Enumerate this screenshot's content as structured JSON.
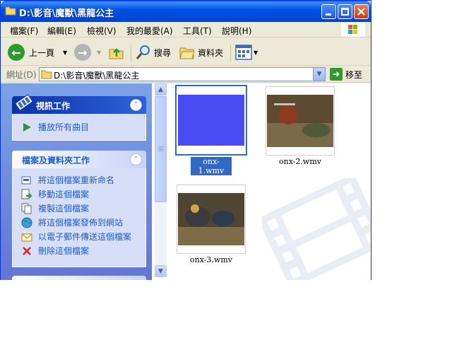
{
  "window": {
    "title": "D:\\影音\\魔獸\\黑龍公主"
  },
  "menubar": {
    "items": [
      "檔案(F)",
      "編輯(E)",
      "檢視(V)",
      "我的最愛(A)",
      "工具(T)",
      "說明(H)"
    ]
  },
  "toolbar": {
    "back_label": "上一頁",
    "search_label": "搜尋",
    "folders_label": "資料夾"
  },
  "address": {
    "label": "網址(D)",
    "value": "D:\\影音\\魔獸\\黑龍公主",
    "go_label": "移至"
  },
  "taskpane": {
    "video_tasks": {
      "title": "視訊工作",
      "items": [
        "播放所有曲目"
      ]
    },
    "file_tasks": {
      "title": "檔案及資料夾工作",
      "items": [
        "將這個檔案重新命名",
        "移動這個檔案",
        "複製這個檔案",
        "將這個檔案發佈到網站",
        "以電子郵件傳送這個檔案",
        "刪除這個檔案"
      ]
    }
  },
  "files": [
    {
      "name": "onx-1.wmv",
      "selected": true
    },
    {
      "name": "onx-2.wmv",
      "selected": false
    },
    {
      "name": "onx-3.wmv",
      "selected": false
    }
  ],
  "colors": {
    "titlebar": "#0055e5",
    "selection": "#316ac5",
    "task_link": "#215dc6",
    "thumb1_fill": "#4b4bf3"
  }
}
